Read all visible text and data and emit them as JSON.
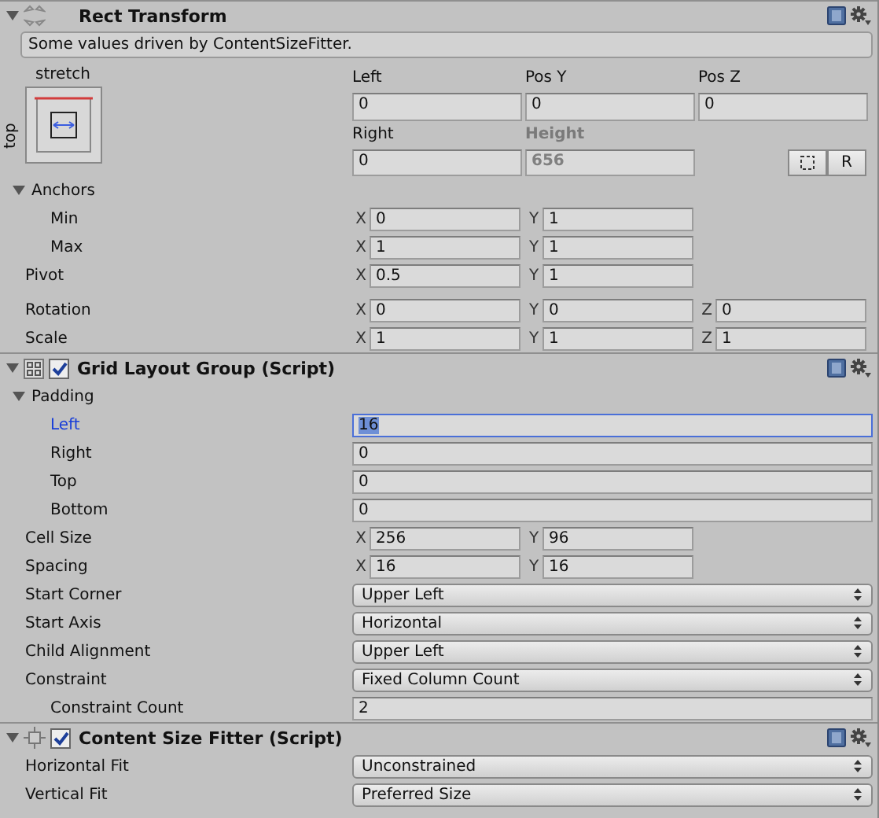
{
  "components": [
    {
      "kind": "rect_transform",
      "title": "Rect Transform",
      "expanded": true,
      "note": "Some values driven by ContentSizeFitter.",
      "anchor_preset": {
        "horizontal": "stretch",
        "vertical": "top"
      },
      "position_fields": [
        {
          "label": "Left",
          "value": "0",
          "disabled": false
        },
        {
          "label": "Pos Y",
          "value": "0",
          "disabled": false
        },
        {
          "label": "Pos Z",
          "value": "0",
          "disabled": false
        },
        {
          "label": "Right",
          "value": "0",
          "disabled": false
        },
        {
          "label": "Height",
          "value": "656",
          "disabled": true
        }
      ],
      "reset_button": {
        "label": "R"
      },
      "rows": [
        {
          "kind": "foldout",
          "label": "Anchors",
          "expanded": true,
          "children": [
            {
              "kind": "vector",
              "label": "Min",
              "axes": [
                {
                  "axis": "X",
                  "value": "0"
                },
                {
                  "axis": "Y",
                  "value": "1"
                }
              ]
            },
            {
              "kind": "vector",
              "label": "Max",
              "axes": [
                {
                  "axis": "X",
                  "value": "1"
                },
                {
                  "axis": "Y",
                  "value": "1"
                }
              ]
            }
          ]
        },
        {
          "kind": "vector",
          "label": "Pivot",
          "axes": [
            {
              "axis": "X",
              "value": "0.5"
            },
            {
              "axis": "Y",
              "value": "1"
            }
          ]
        }
      ],
      "rows_after_gap": [
        {
          "kind": "vector",
          "label": "Rotation",
          "axes": [
            {
              "axis": "X",
              "value": "0"
            },
            {
              "axis": "Y",
              "value": "0"
            },
            {
              "axis": "Z",
              "value": "0"
            }
          ]
        },
        {
          "kind": "vector",
          "label": "Scale",
          "axes": [
            {
              "axis": "X",
              "value": "1"
            },
            {
              "axis": "Y",
              "value": "1"
            },
            {
              "axis": "Z",
              "value": "1"
            }
          ]
        }
      ]
    },
    {
      "kind": "grid_layout",
      "title": "Grid Layout Group (Script)",
      "expanded": true,
      "enabled": true,
      "rows": [
        {
          "kind": "foldout",
          "label": "Padding",
          "expanded": true,
          "children": [
            {
              "kind": "field",
              "label": "Left",
              "value": "16",
              "focused": true
            },
            {
              "kind": "field",
              "label": "Right",
              "value": "0",
              "focused": false
            },
            {
              "kind": "field",
              "label": "Top",
              "value": "0",
              "focused": false
            },
            {
              "kind": "field",
              "label": "Bottom",
              "value": "0",
              "focused": false
            }
          ]
        },
        {
          "kind": "vector",
          "label": "Cell Size",
          "axes": [
            {
              "axis": "X",
              "value": "256"
            },
            {
              "axis": "Y",
              "value": "96"
            }
          ]
        },
        {
          "kind": "vector",
          "label": "Spacing",
          "axes": [
            {
              "axis": "X",
              "value": "16"
            },
            {
              "axis": "Y",
              "value": "16"
            }
          ]
        },
        {
          "kind": "dropdown",
          "label": "Start Corner",
          "value": "Upper Left"
        },
        {
          "kind": "dropdown",
          "label": "Start Axis",
          "value": "Horizontal"
        },
        {
          "kind": "dropdown",
          "label": "Child Alignment",
          "value": "Upper Left"
        },
        {
          "kind": "dropdown",
          "label": "Constraint",
          "value": "Fixed Column Count",
          "children": [
            {
              "kind": "field",
              "label": "Constraint Count",
              "value": "2",
              "focused": false
            }
          ]
        }
      ]
    },
    {
      "kind": "size_fitter",
      "title": "Content Size Fitter (Script)",
      "expanded": true,
      "enabled": true,
      "rows": [
        {
          "kind": "dropdown",
          "label": "Horizontal Fit",
          "value": "Unconstrained"
        },
        {
          "kind": "dropdown",
          "label": "Vertical Fit",
          "value": "Preferred Size"
        }
      ]
    }
  ]
}
